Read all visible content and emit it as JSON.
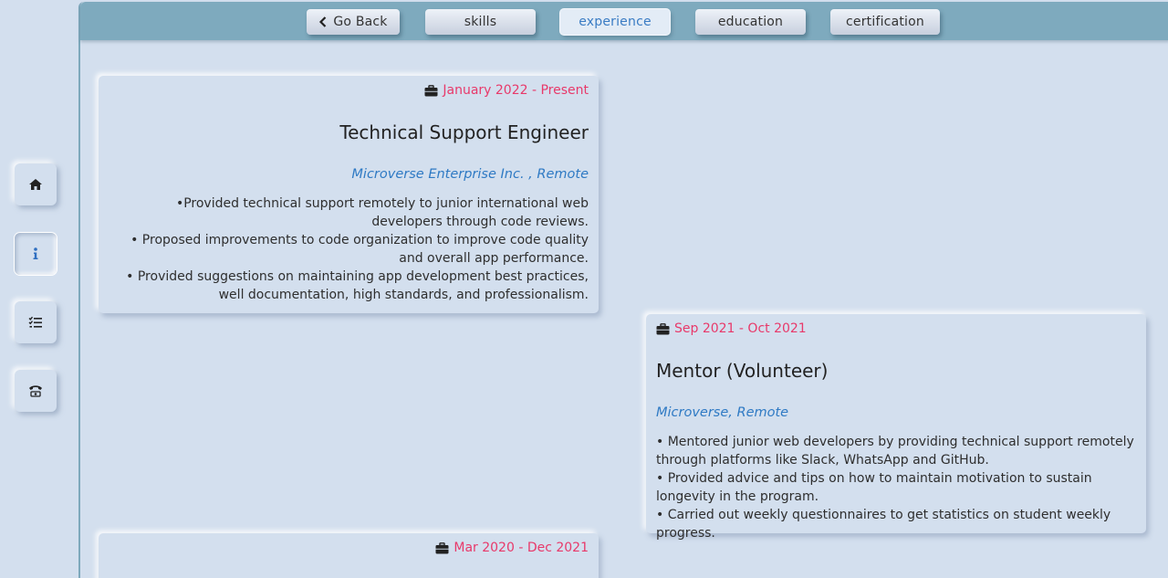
{
  "tabs": {
    "go_back": "Go Back",
    "skills": "skills",
    "experience": "experience",
    "education": "education",
    "certification": "certification"
  },
  "sidebar": {
    "items": [
      {
        "icon": "home-icon"
      },
      {
        "icon": "info-icon",
        "active": true
      },
      {
        "icon": "list-check-icon"
      },
      {
        "icon": "phone-icon"
      }
    ]
  },
  "experience": [
    {
      "date": "January 2022 - Present",
      "title": "Technical Support Engineer",
      "company": "Microverse Enterprise Inc. , Remote",
      "bullets": [
        "•Provided technical support remotely to junior international web developers through code reviews.",
        "• Proposed improvements to code organization to improve code quality and overall app performance.",
        "• Provided suggestions on maintaining app development best practices, well documentation, high standards, and professionalism."
      ]
    },
    {
      "date": "Sep 2021 - Oct 2021",
      "title": "Mentor (Volunteer)",
      "company": "Microverse, Remote",
      "bullets": [
        "• Mentored junior web developers by providing technical support remotely through platforms like Slack, WhatsApp and GitHub.",
        "• Provided advice and tips on how to maintain motivation to sustain longevity in the program.",
        "• Carried out weekly questionnaires to get statistics on student weekly progress."
      ]
    },
    {
      "date": "Mar 2020 - Dec 2021"
    }
  ],
  "colors": {
    "background": "#d3dfee",
    "topbar": "#7eaabe",
    "date": "#e8396a",
    "company": "#2f7ac4",
    "active_tab_text": "#3a7cc4"
  }
}
